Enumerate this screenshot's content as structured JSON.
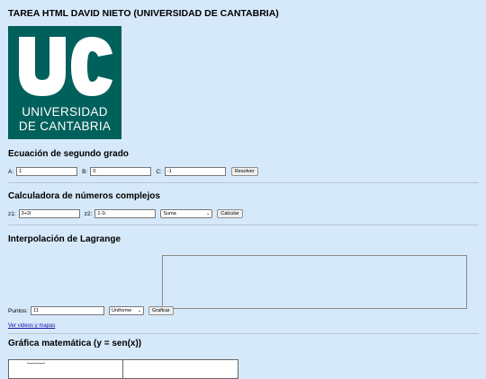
{
  "page": {
    "title": "TAREA HTML DAVID NIETO (UNIVERSIDAD DE CANTABRIA)"
  },
  "logo": {
    "monogram": "UC",
    "line1": "UNIVERSIDAD",
    "line2": "DE CANTABRIA",
    "color": "#00605c"
  },
  "quadratic": {
    "heading": "Ecuación de segundo grado",
    "a_label": "A:",
    "a_value": "1",
    "b_label": "B:",
    "b_value": "0",
    "c_label": "C:",
    "c_value": "-1",
    "solve_button": "Resolver"
  },
  "complex": {
    "heading": "Calculadora de números complejos",
    "z1_label": "z1:",
    "z1_value": "3+2i",
    "z2_label": "z2:",
    "z2_value": "1-1i",
    "operation": "Suma",
    "calc_button": "Calcular"
  },
  "lagrange": {
    "heading": "Interpolación de Lagrange",
    "points_label": "Puntos:",
    "points_value": "11",
    "distribution": "Uniforme",
    "plot_button": "Graficar"
  },
  "links": {
    "videos": "Ver videos y mapas"
  },
  "graph": {
    "heading": "Gráfica matemática (y = sen(x))"
  },
  "colors": {
    "background": "#d6e9fa",
    "link": "#1a0dab"
  }
}
